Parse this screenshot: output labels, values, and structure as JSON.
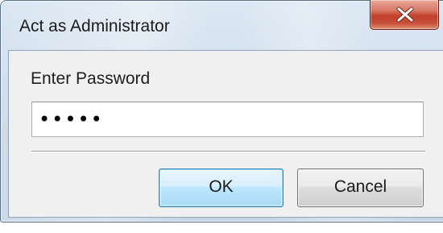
{
  "window": {
    "title": "Act as Administrator",
    "close_icon": "close-icon"
  },
  "dialog": {
    "prompt": "Enter Password",
    "password_value": "•••••",
    "ok_label": "OK",
    "cancel_label": "Cancel"
  },
  "colors": {
    "frame": "#cdd9e6",
    "close_button": "#c2412a",
    "client_background": "#f0f0f0",
    "default_button_border": "#3c7fb1"
  }
}
